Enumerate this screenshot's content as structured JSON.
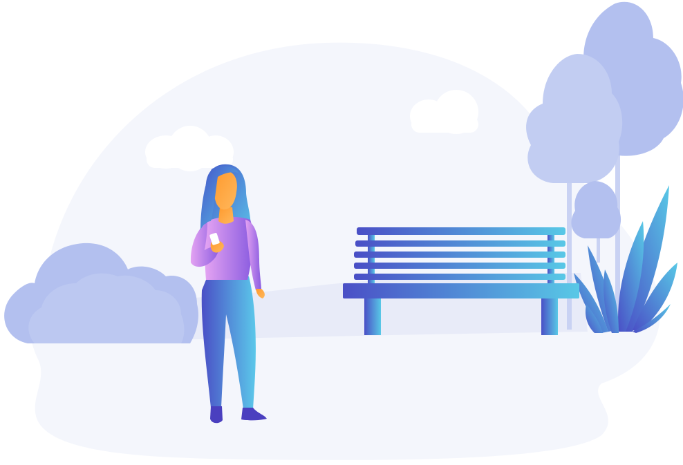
{
  "illustration": {
    "subject": "woman-holding-phone-in-park",
    "elements": [
      "background-blob",
      "cloud",
      "cloud",
      "bush",
      "tree",
      "tree",
      "fern-plant",
      "park-bench",
      "woman"
    ]
  },
  "colors": {
    "background": "#ffffff",
    "ground": "#f4f6fc",
    "hill": "#e8ebf8",
    "foliage": "#b3c0ef",
    "foliage_light": "#c2cdf2",
    "trunk": "#c9d2f3",
    "cloud": "#ffffff",
    "bench_start": "#4a4fc6",
    "bench_end": "#58c8e6",
    "hair_start": "#4456c9",
    "hair_end": "#5bc2e8",
    "skin_start": "#ff9a2e",
    "skin_end": "#ffb85c",
    "shirt_start": "#e4a3f2",
    "shirt_end": "#8a5ce0",
    "pants_start": "#4a4fc6",
    "pants_end": "#5bc8ea",
    "shoe": "#4a3fbf",
    "phone": "#ffffff"
  }
}
